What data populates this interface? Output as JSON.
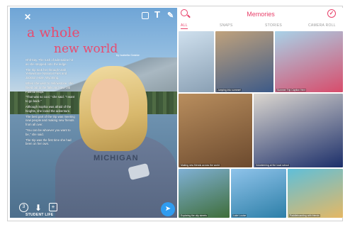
{
  "story": {
    "headline_line1": "a whole",
    "headline_line2": "new world",
    "byline": "by Isabella Gatzke",
    "paragraphs": [
      "Ohh-kay. The rush of adrenaline hit as she stepped onto the ledge.",
      "The trip took her through Utah, Yellowstone National Park and Jackson Hole, Wyoming.",
      "When she went to Yellowstone, she hiked out to the falls and saw Old Faithful erupt.",
      "\"That was so cool,\" she said. \"I want to go back.\"",
      "Although Sophia was afraid of the heights, she loved the adventure.",
      "The best part of the trip was meeting new people and making new friends from all over.",
      "\"You can be whoever you want to be,\" she said.",
      "The trip was the first time she had been on her own."
    ],
    "shirt_text": "MICHIGAN",
    "brand_label": "STUDENT LIFE",
    "icons": {
      "close": "close-icon",
      "sticker": "sticker-icon",
      "text": "text-icon",
      "pen": "pen-icon",
      "timer": "timer-icon",
      "save": "download-icon",
      "add_story": "add-story-icon",
      "send": "send-icon"
    },
    "glyphs": {
      "close": "✕",
      "text": "T",
      "pen": "✎",
      "timer": "3",
      "save": "⬇",
      "add_story": "+",
      "send": "➤"
    }
  },
  "memories": {
    "title": "Memories",
    "tabs": [
      {
        "label": "ALL",
        "active": true
      },
      {
        "label": "SNAPS",
        "active": false
      },
      {
        "label": "STORIES",
        "active": false
      },
      {
        "label": "CAMERA ROLL",
        "active": false
      }
    ],
    "select_glyph": "✓",
    "tiles": [
      {
        "caption": "",
        "colors": [
          "#cfe0ee",
          "#8aa0b4"
        ]
      },
      {
        "caption": "Jumping into summer!",
        "colors": [
          "#c0a27c",
          "#3d5a88"
        ]
      },
      {
        "caption": "Summer Trip Caption Here",
        "colors": [
          "#a8d2e8",
          "#d84c6b"
        ]
      },
      {
        "caption": "Making new friends across the world",
        "colors": [
          "#b98e5e",
          "#6c4a2e"
        ]
      },
      {
        "caption": "Volunteering at the local school",
        "colors": [
          "#dcd7d0",
          "#1c2f6a"
        ]
      },
      {
        "caption": "Exploring the city streets",
        "colors": [
          "#7fb0d4",
          "#3f6e3a"
        ]
      },
      {
        "caption": "Lake Louise",
        "colors": [
          "#8fc3ea",
          "#2d7fa8"
        ]
      },
      {
        "caption": "Paddleboarding with friends",
        "colors": [
          "#5fbfd9",
          "#e5b864"
        ]
      }
    ]
  }
}
